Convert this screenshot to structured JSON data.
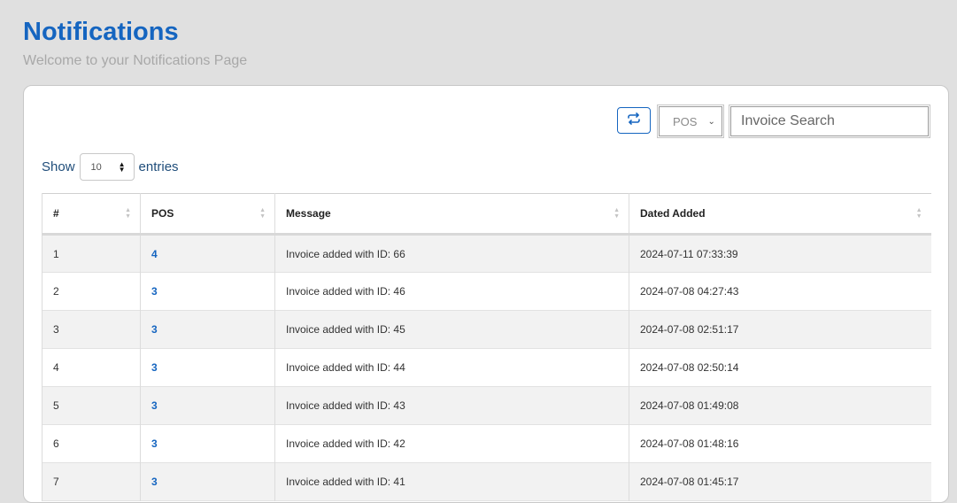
{
  "header": {
    "title": "Notifications",
    "subtitle": "Welcome to your Notifications Page"
  },
  "toolbar": {
    "refresh_icon": "refresh-icon",
    "pos_filter": {
      "selected": "POS"
    },
    "search": {
      "placeholder": "Invoice Search",
      "value": ""
    }
  },
  "length_menu": {
    "show_label": "Show",
    "value": "10",
    "entries_label": "entries"
  },
  "table": {
    "columns": [
      "#",
      "POS",
      "Message",
      "Dated Added"
    ],
    "rows": [
      {
        "num": "1",
        "pos": "4",
        "message": "Invoice added with ID: 66",
        "date": "2024-07-11 07:33:39"
      },
      {
        "num": "2",
        "pos": "3",
        "message": "Invoice added with ID: 46",
        "date": "2024-07-08 04:27:43"
      },
      {
        "num": "3",
        "pos": "3",
        "message": "Invoice added with ID: 45",
        "date": "2024-07-08 02:51:17"
      },
      {
        "num": "4",
        "pos": "3",
        "message": "Invoice added with ID: 44",
        "date": "2024-07-08 02:50:14"
      },
      {
        "num": "5",
        "pos": "3",
        "message": "Invoice added with ID: 43",
        "date": "2024-07-08 01:49:08"
      },
      {
        "num": "6",
        "pos": "3",
        "message": "Invoice added with ID: 42",
        "date": "2024-07-08 01:48:16"
      },
      {
        "num": "7",
        "pos": "3",
        "message": "Invoice added with ID: 41",
        "date": "2024-07-08 01:45:17"
      }
    ]
  },
  "colors": {
    "accent": "#1565c0",
    "background": "#e0e0e0",
    "row_stripe": "#f2f2f2"
  }
}
